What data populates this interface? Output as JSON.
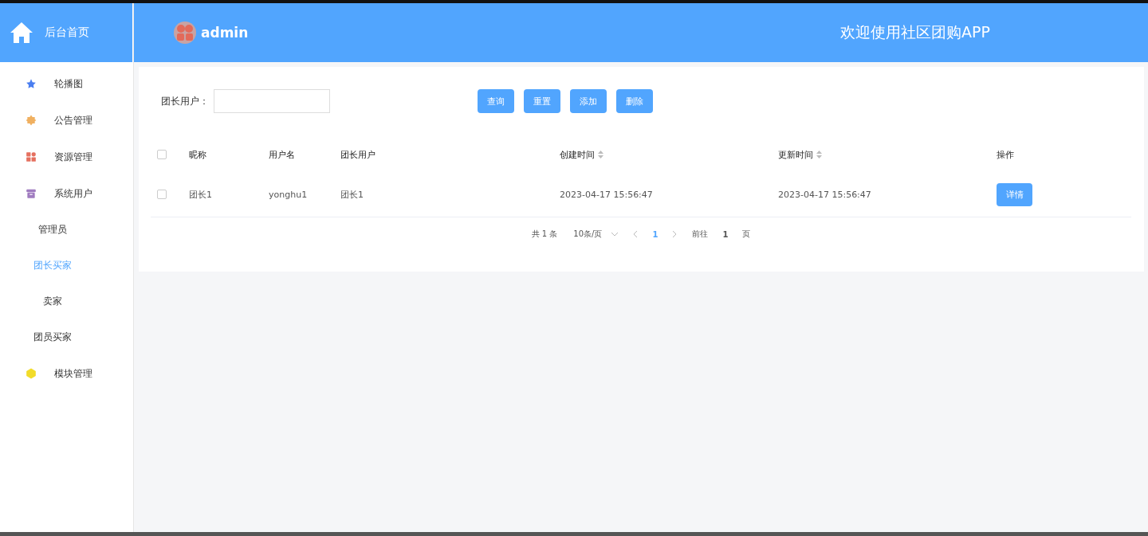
{
  "brand": {
    "title": "后台首页"
  },
  "header": {
    "user": "admin",
    "welcome": "欢迎使用社区团购APP"
  },
  "sidebar": {
    "items": [
      {
        "label": "轮播图"
      },
      {
        "label": "公告管理"
      },
      {
        "label": "资源管理"
      },
      {
        "label": "系统用户",
        "children": [
          {
            "label": "管理员",
            "selected": false
          },
          {
            "label": "团长买家",
            "selected": true
          },
          {
            "label": "卖家",
            "selected": false
          },
          {
            "label": "团员买家",
            "selected": false
          }
        ]
      },
      {
        "label": "模块管理"
      }
    ]
  },
  "search": {
    "label": "团长用户："
  },
  "buttons": [
    "查询",
    "重置",
    "添加",
    "删除"
  ],
  "table": {
    "all_checked": false,
    "columns": [
      {
        "label": "昵称",
        "sortable": false
      },
      {
        "label": "用户名",
        "sortable": false
      },
      {
        "label": "团长用户",
        "sortable": false
      },
      {
        "label": "创建时间",
        "sortable": true
      },
      {
        "label": "更新时间",
        "sortable": true
      },
      {
        "label": "操作",
        "sortable": false
      }
    ],
    "rows": [
      {
        "checked": false,
        "cells": [
          "团长1",
          "yonghu1",
          "团长1",
          "2023-04-17 15:56:47",
          "2023-04-17 15:56:47"
        ],
        "action": "详情"
      }
    ]
  },
  "pagination": {
    "total": "共 1 条",
    "page_size": "10条/页",
    "pages": [
      {
        "label": "1",
        "selected": true
      }
    ],
    "goto_label": "前往",
    "goto_value": "1",
    "goto_suffix": "页"
  }
}
